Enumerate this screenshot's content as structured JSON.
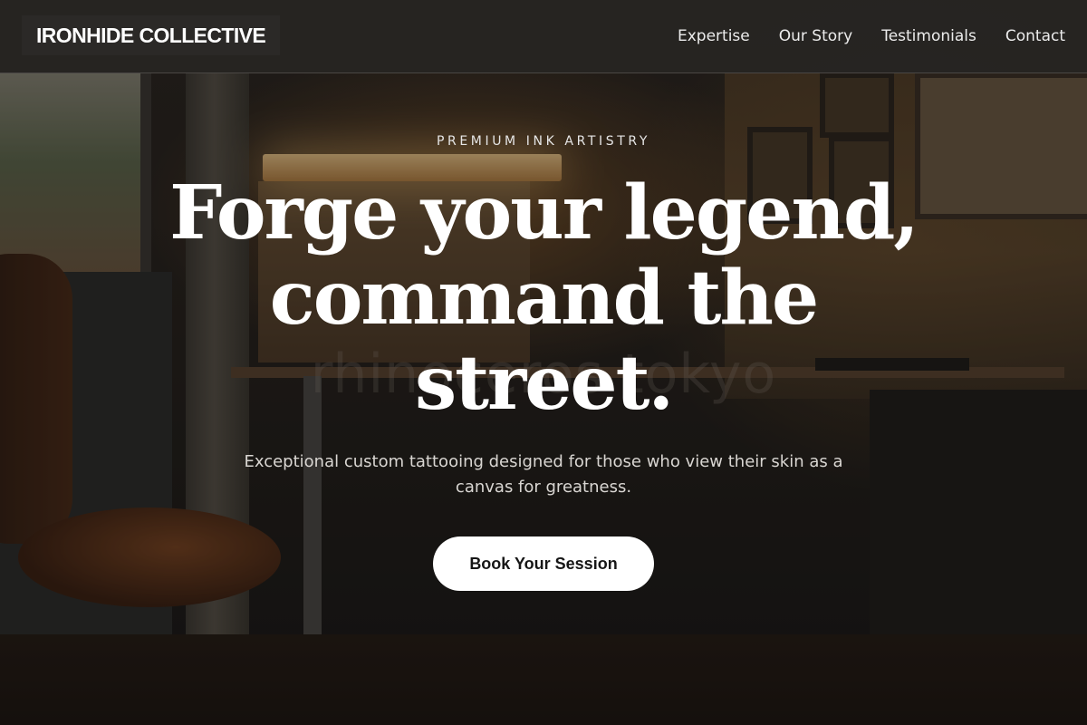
{
  "brand": {
    "name": "IRONHIDE COLLECTIVE"
  },
  "nav": {
    "items": [
      {
        "label": "Expertise"
      },
      {
        "label": "Our Story"
      },
      {
        "label": "Testimonials"
      },
      {
        "label": "Contact"
      }
    ]
  },
  "hero": {
    "eyebrow": "PREMIUM INK ARTISTRY",
    "headline": "Forge your legend, command the street.",
    "subheading": "Exceptional custom tattooing designed for those who view their skin as a canvas for greatness.",
    "cta_label": "Book Your Session",
    "background_watermark": "rhinoceros tokyo"
  },
  "colors": {
    "nav_background": "#262422",
    "cta_background": "#ffffff",
    "cta_text": "#161616",
    "headline_text": "#ffffff"
  }
}
